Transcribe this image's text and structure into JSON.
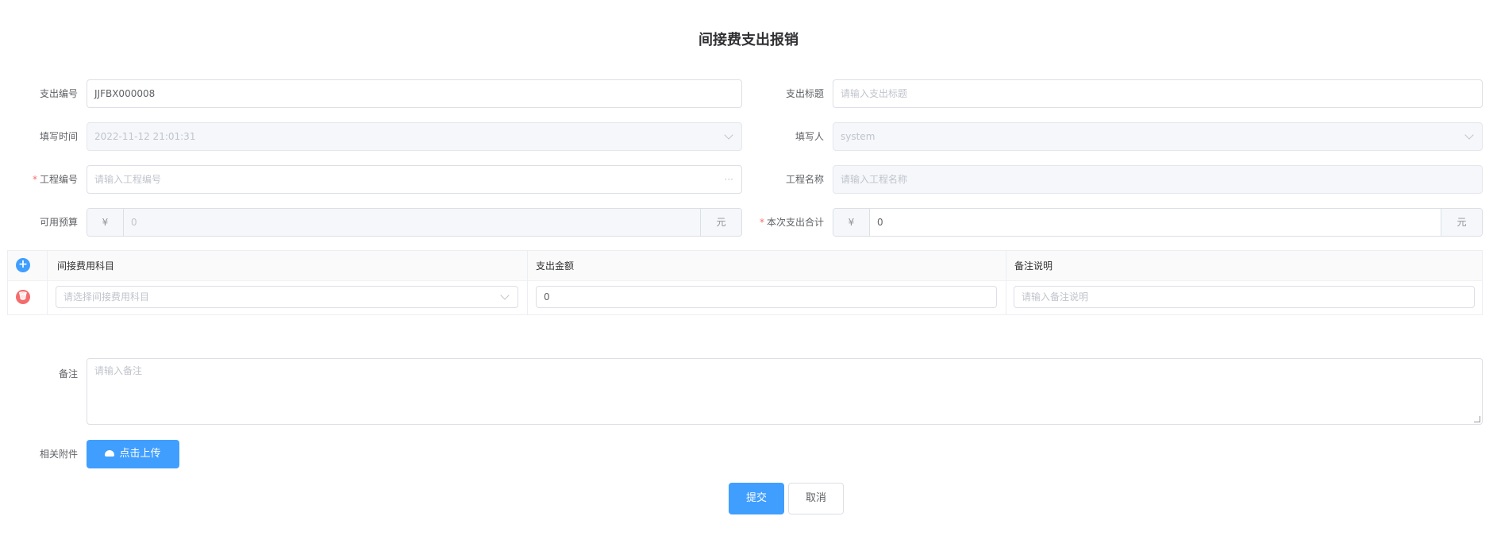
{
  "title": "间接费支出报销",
  "fields": {
    "expense_no": {
      "label": "支出编号",
      "value": "JJFBX000008"
    },
    "expense_title": {
      "label": "支出标题",
      "placeholder": "请输入支出标题"
    },
    "fill_time": {
      "label": "填写时间",
      "value": "2022-11-12 21:01:31"
    },
    "filler": {
      "label": "填写人",
      "value": "system"
    },
    "project_no": {
      "label": "工程编号",
      "placeholder": "请输入工程编号",
      "required": "*",
      "suffix": "···"
    },
    "project_name": {
      "label": "工程名称",
      "placeholder": "请输入工程名称"
    },
    "available_budget": {
      "label": "可用预算",
      "prefix": "¥",
      "value": "0",
      "suffix": "元"
    },
    "total_expense": {
      "label": "本次支出合计",
      "required": "*",
      "prefix": "¥",
      "value": "0",
      "suffix": "元"
    }
  },
  "grid": {
    "add_icon": "+",
    "delete_icon": "🗑",
    "columns": [
      "间接费用科目",
      "支出金额",
      "备注说明"
    ],
    "rows": [
      {
        "subject_placeholder": "请选择间接费用科目",
        "amount": "0",
        "note_placeholder": "请输入备注说明"
      }
    ]
  },
  "remark": {
    "label": "备注",
    "placeholder": "请输入备注"
  },
  "attachment": {
    "label": "相关附件",
    "upload_label": "点击上传"
  },
  "actions": {
    "submit": "提交",
    "cancel": "取消"
  },
  "colors": {
    "primary": "#409eff",
    "danger": "#f56c6c"
  }
}
